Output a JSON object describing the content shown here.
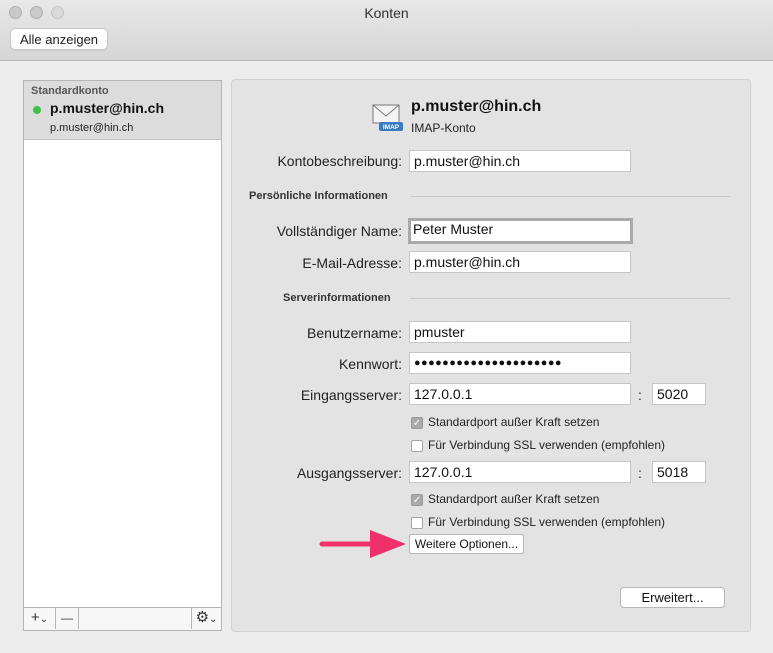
{
  "window": {
    "title": "Konten",
    "show_all_label": "Alle anzeigen"
  },
  "sidebar": {
    "section_label": "Standardkonto",
    "accounts": [
      {
        "name": "p.muster@hin.ch",
        "subtitle": "p.muster@hin.ch",
        "status_color": "#3cc24a"
      }
    ],
    "toolbar": {
      "add_label": "+",
      "add_menu_label": "⌄",
      "remove_label": "—",
      "action_label": "⚙"
    }
  },
  "account": {
    "header_name": "p.muster@hin.ch",
    "header_type": "IMAP-Konto",
    "icon_badge": "IMAP",
    "description_label": "Kontobeschreibung:",
    "description_value": "p.muster@hin.ch"
  },
  "personal": {
    "heading": "Persönliche Informationen",
    "full_name_label": "Vollständiger Name:",
    "full_name_value": "Peter Muster",
    "email_label": "E-Mail-Adresse:",
    "email_value": "p.muster@hin.ch"
  },
  "server": {
    "heading": "Serverinformationen",
    "username_label": "Benutzername:",
    "username_value": "pmuster",
    "password_label": "Kennwort:",
    "password_value": "●●●●●●●●●●●●●●●●●●●●●",
    "incoming_label": "Eingangsserver:",
    "incoming_host": "127.0.0.1",
    "incoming_port": "5020",
    "incoming_override_label": "Standardport außer Kraft setzen",
    "incoming_override_checked": true,
    "incoming_ssl_label": "Für Verbindung SSL verwenden (empfohlen)",
    "incoming_ssl_checked": false,
    "outgoing_label": "Ausgangsserver:",
    "outgoing_host": "127.0.0.1",
    "outgoing_port": "5018",
    "outgoing_override_label": "Standardport außer Kraft setzen",
    "outgoing_override_checked": true,
    "outgoing_ssl_label": "Für Verbindung SSL verwenden (empfohlen)",
    "outgoing_ssl_checked": false,
    "more_options_label": "Weitere Optionen...",
    "port_separator": ":"
  },
  "footer": {
    "advanced_label": "Erweitert..."
  },
  "annotation": {
    "arrow_color": "#f0306a"
  }
}
